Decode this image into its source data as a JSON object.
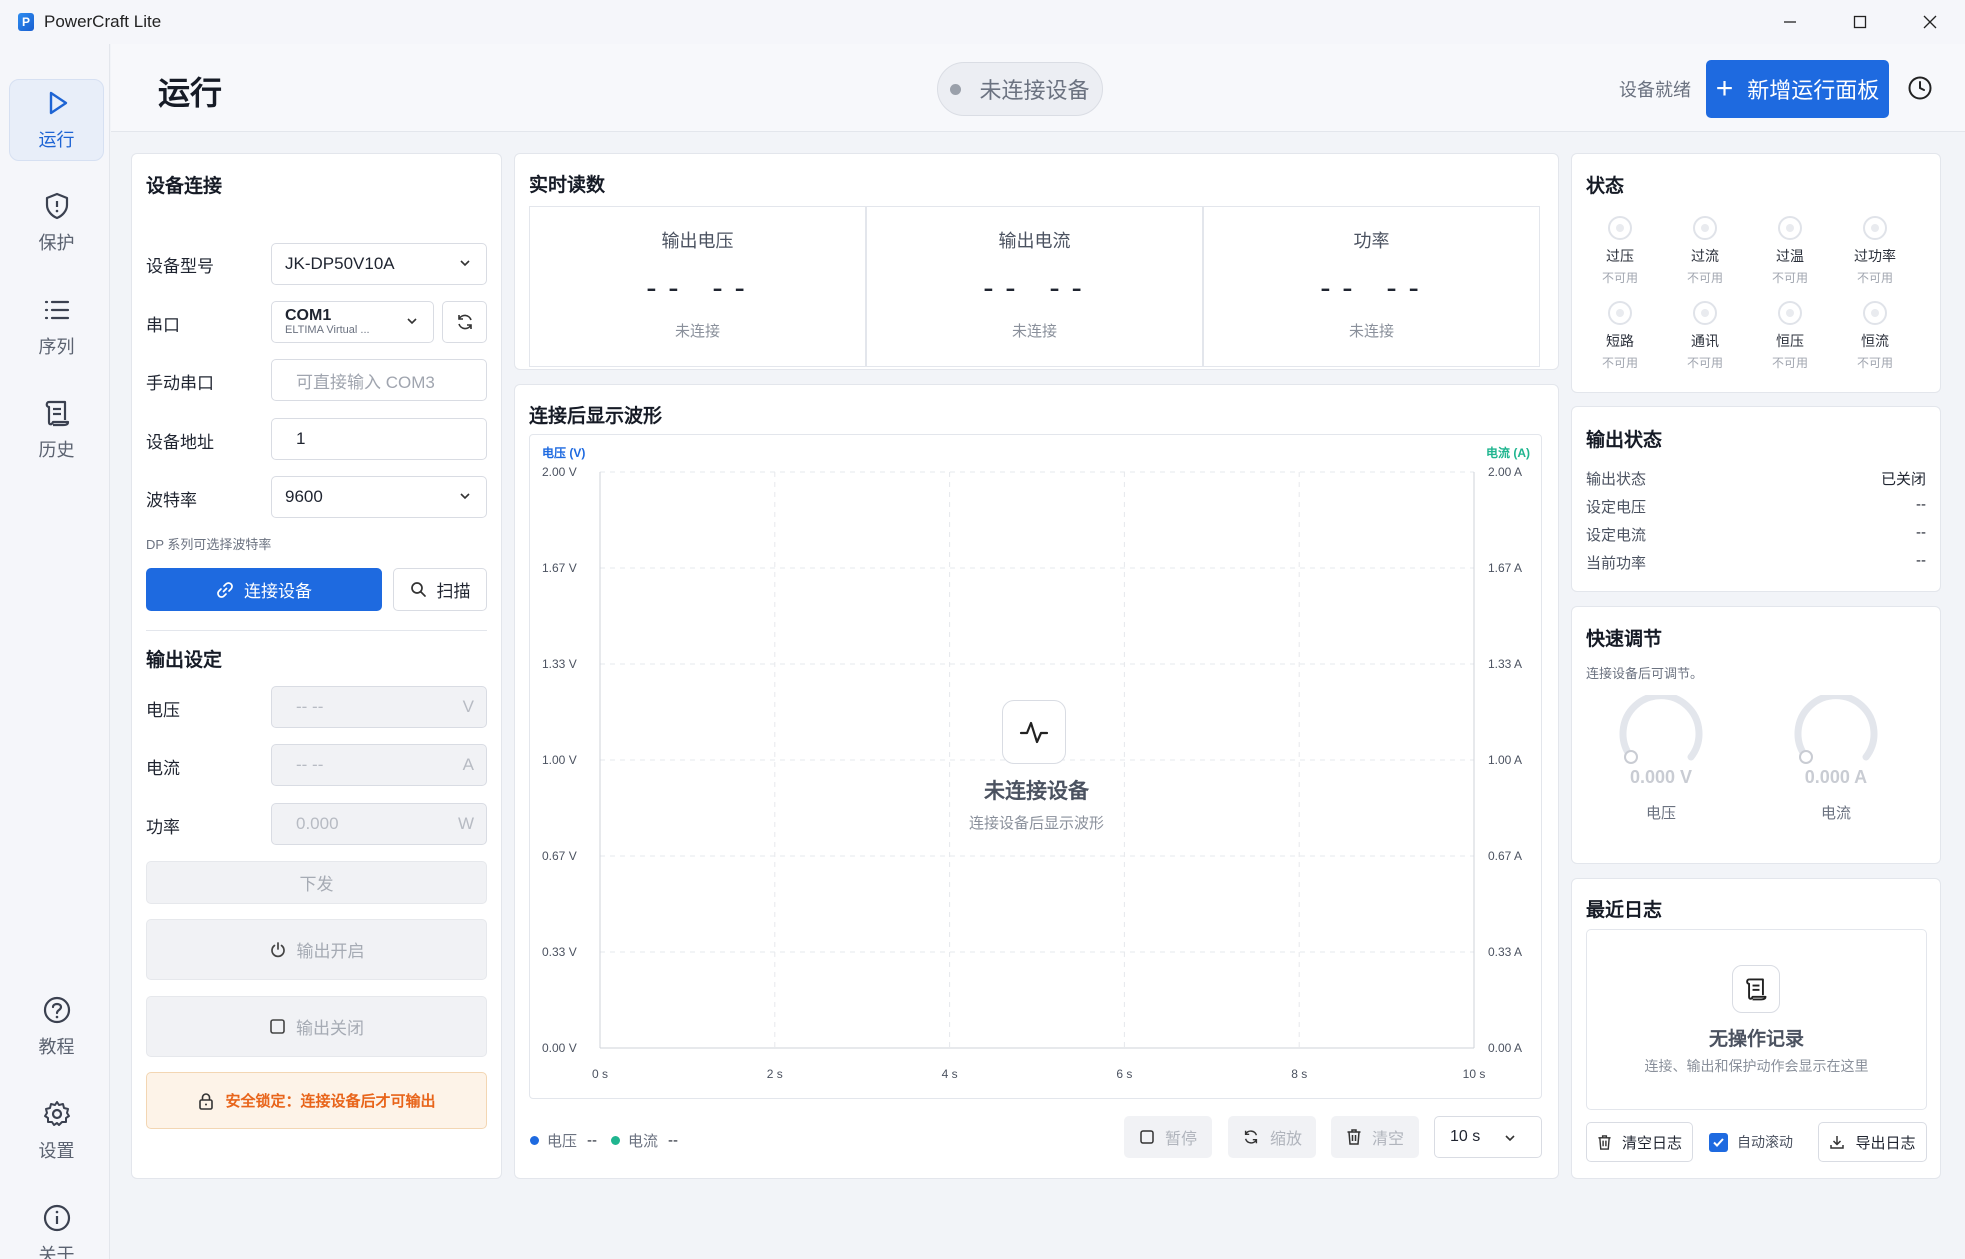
{
  "app": {
    "title": "PowerCraft Lite"
  },
  "sidebar": {
    "items": [
      {
        "label": "运行",
        "icon": "play-icon"
      },
      {
        "label": "保护",
        "icon": "shield-icon"
      },
      {
        "label": "序列",
        "icon": "list-icon"
      },
      {
        "label": "历史",
        "icon": "scroll-icon"
      },
      {
        "label": "教程",
        "icon": "help-icon"
      },
      {
        "label": "设置",
        "icon": "gear-icon"
      },
      {
        "label": "关于",
        "icon": "info-icon"
      }
    ]
  },
  "header": {
    "title": "运行",
    "connection_status": "未连接设备",
    "ready_text": "设备就绪",
    "add_button": "新增运行面板"
  },
  "device": {
    "title": "设备连接",
    "model_label": "设备型号",
    "model_value": "JK-DP50V10A",
    "port_label": "串口",
    "port_value": "COM1",
    "port_sub": "ELTIMA Virtual ...",
    "manual_label": "手动串口",
    "manual_placeholder": "可直接输入 COM3",
    "address_label": "设备地址",
    "address_value": "1",
    "baud_label": "波特率",
    "baud_value": "9600",
    "hint": "DP 系列可选择波特率",
    "connect_button": "连接设备",
    "scan_button": "扫描"
  },
  "output_settings": {
    "title": "输出设定",
    "voltage_label": "电压",
    "voltage_value": "-- --",
    "voltage_unit": "V",
    "current_label": "电流",
    "current_value": "-- --",
    "current_unit": "A",
    "power_label": "功率",
    "power_value": "0.000",
    "power_unit": "W",
    "send_button": "下发",
    "on_button": "输出开启",
    "off_button": "输出关闭",
    "lock_text": "安全锁定：连接设备后才可输出"
  },
  "realtime": {
    "title": "实时读数",
    "readouts": [
      {
        "label": "输出电压",
        "value": "-- --",
        "status": "未连接"
      },
      {
        "label": "输出电流",
        "value": "-- --",
        "status": "未连接"
      },
      {
        "label": "功率",
        "value": "-- --",
        "status": "未连接"
      }
    ]
  },
  "waveform": {
    "title": "连接后显示波形",
    "left_axis_label": "电压 (V)",
    "right_axis_label": "电流 (A)",
    "left_ticks": [
      "2.00 V",
      "1.67 V",
      "1.33 V",
      "1.00 V",
      "0.67 V",
      "0.33 V",
      "0.00 V"
    ],
    "right_ticks": [
      "2.00 A",
      "1.67 A",
      "1.33 A",
      "1.00 A",
      "0.67 A",
      "0.33 A",
      "0.00 A"
    ],
    "x_ticks": [
      "0 s",
      "2 s",
      "4 s",
      "6 s",
      "8 s",
      "10 s"
    ],
    "empty_title": "未连接设备",
    "empty_sub": "连接设备后显示波形",
    "legend_voltage": "电压",
    "legend_voltage_value": "--",
    "legend_current": "电流",
    "legend_current_value": "--",
    "pause_button": "暂停",
    "zoom_button": "缩放",
    "clear_button": "清空",
    "window_select": "10 s",
    "colors": {
      "voltage": "#1e6ae0",
      "current": "#1fb58f"
    }
  },
  "chart_data": {
    "type": "line",
    "x": [],
    "series": [
      {
        "name": "电压",
        "values": []
      },
      {
        "name": "电流",
        "values": []
      }
    ],
    "xlabel": "",
    "ylabel": "电压 (V)",
    "y2label": "电流 (A)",
    "xlim": [
      0,
      10
    ],
    "ylim": [
      0,
      2
    ],
    "y2lim": [
      0,
      2
    ],
    "grid": true
  },
  "status": {
    "title": "状态",
    "items": [
      {
        "name": "过压",
        "state": "不可用"
      },
      {
        "name": "过流",
        "state": "不可用"
      },
      {
        "name": "过温",
        "state": "不可用"
      },
      {
        "name": "过功率",
        "state": "不可用"
      },
      {
        "name": "短路",
        "state": "不可用"
      },
      {
        "name": "通讯",
        "state": "不可用"
      },
      {
        "name": "恒压",
        "state": "不可用"
      },
      {
        "name": "恒流",
        "state": "不可用"
      }
    ]
  },
  "output_status": {
    "title": "输出状态",
    "rows": [
      {
        "k": "输出状态",
        "v": "已关闭"
      },
      {
        "k": "设定电压",
        "v": "--"
      },
      {
        "k": "设定电流",
        "v": "--"
      },
      {
        "k": "当前功率",
        "v": "--"
      }
    ]
  },
  "quick": {
    "title": "快速调节",
    "hint": "连接设备后可调节。",
    "voltage_value": "0.000 V",
    "voltage_label": "电压",
    "current_value": "0.000 A",
    "current_label": "电流"
  },
  "log": {
    "title": "最近日志",
    "empty_title": "无操作记录",
    "empty_sub": "连接、输出和保护动作会显示在这里",
    "clear_button": "清空日志",
    "autoscroll_label": "自动滚动",
    "export_button": "导出日志"
  }
}
